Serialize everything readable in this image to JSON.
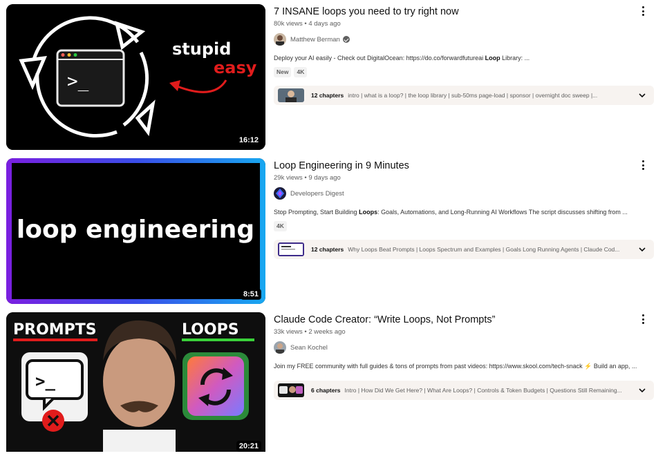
{
  "results": [
    {
      "title": "7 INSANE loops you need to try right now",
      "views": "80k views",
      "age": "4 days ago",
      "channel": "Matthew Berman",
      "verified": true,
      "desc_pre": "Deploy your AI easily - Check out DigitalOcean: https://do.co/forwardfutureai ",
      "desc_bold": "Loop",
      "desc_post": " Library: ...",
      "badges": [
        "New",
        "4K"
      ],
      "duration": "16:12",
      "thumb_text1": "stupid",
      "thumb_text2": "easy",
      "thumb_prompt": ">_",
      "chapters_count": "12 chapters",
      "chapters_list": "intro | what is a loop? | the loop library | sub-50ms page-load | sponsor | overnight doc sweep |..."
    },
    {
      "title": "Loop Engineering in 9 Minutes",
      "views": "29k views",
      "age": "9 days ago",
      "channel": "Developers Digest",
      "verified": false,
      "desc_pre": "Stop Prompting, Start Building ",
      "desc_bold": "Loops",
      "desc_post": ": Goals, Automations, and Long-Running AI Workflows The script discusses shifting from ...",
      "badges": [
        "4K"
      ],
      "duration": "8:51",
      "thumb_text1": "loop engineering",
      "chapters_count": "12 chapters",
      "chapters_list": "Why Loops Beat Prompts | Loops Spectrum and Examples | Goals Long Running Agents | Claude Cod..."
    },
    {
      "title": "Claude Code Creator: “Write Loops, Not Prompts”",
      "views": "33k views",
      "age": "2 weeks ago",
      "channel": "Sean Kochel",
      "verified": false,
      "desc_pre": "Join my FREE community with full guides & tons of prompts from past videos: https://www.skool.com/tech-snack ",
      "desc_bold": "",
      "desc_post": "⚡ Build an app, ...",
      "badges": [],
      "duration": "20:21",
      "thumb_text1": "PROMPTS",
      "thumb_text2": "LOOPS",
      "chapters_count": "6 chapters",
      "chapters_list": "Intro | How Did We Get Here? | What Are Loops? | Controls & Token Budgets | Questions Still Remaining..."
    }
  ],
  "meta_separator": "•",
  "colors": {
    "accent_red": "#e11c1c",
    "gradient_start": "#7a1fe0",
    "gradient_end": "#18a8f0",
    "chapters_bg": "#f7f3f0"
  }
}
